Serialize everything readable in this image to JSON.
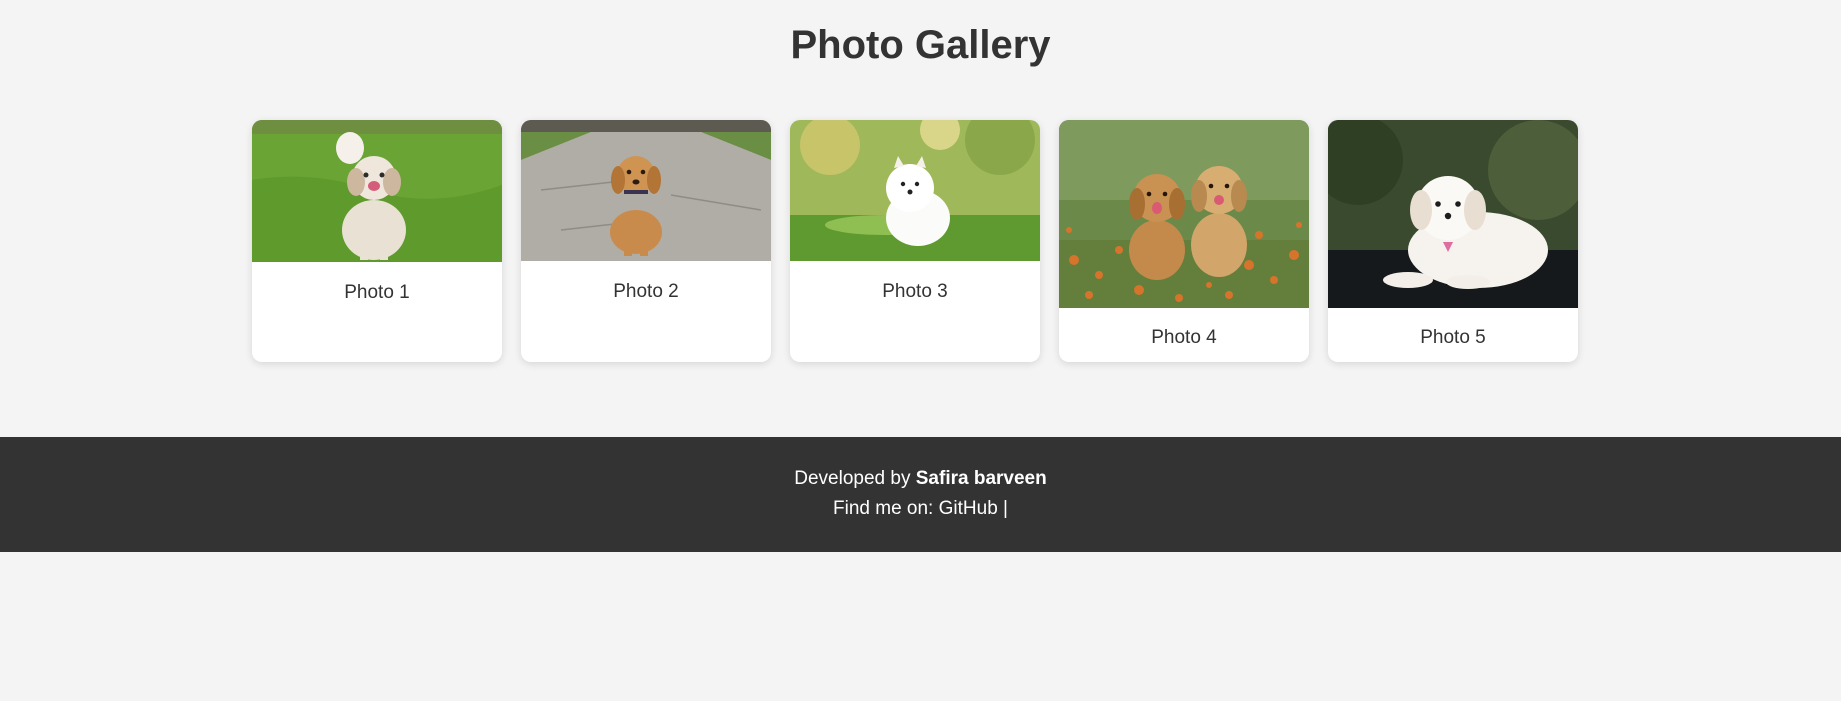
{
  "page": {
    "title": "Photo Gallery"
  },
  "gallery": {
    "items": [
      {
        "caption": "Photo 1",
        "icon": "puppy-shihtzu-on-grass-image"
      },
      {
        "caption": "Photo 2",
        "icon": "golden-retriever-puppy-on-path-image"
      },
      {
        "caption": "Photo 3",
        "icon": "white-pomeranian-puppy-image"
      },
      {
        "caption": "Photo 4",
        "icon": "two-golden-puppies-in-flowers-image"
      },
      {
        "caption": "Photo 5",
        "icon": "white-maltese-puppy-image"
      }
    ]
  },
  "footer": {
    "developed_by_prefix": "Developed by",
    "developer_name": "Safira barveen",
    "find_me_prefix": "Find me on:",
    "github_link": "GitHub",
    "separator": "|"
  },
  "colors": {
    "background": "#f4f4f4",
    "card": "#ffffff",
    "footer": "#333333",
    "text": "#333333"
  }
}
